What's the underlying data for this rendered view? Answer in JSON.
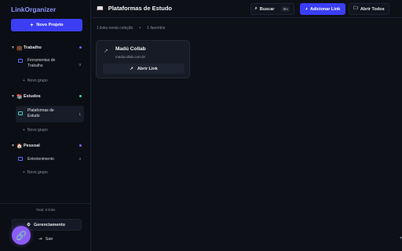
{
  "app": {
    "brand": "LinkOrganizer"
  },
  "sidebar": {
    "new_project_label": "Novo Projeto",
    "groups": [
      {
        "name": "Trabalho",
        "emoji": "💼",
        "dot_color": "#6366f1",
        "collections": [
          {
            "name": "Ferramentas de Trabalho",
            "count": "3"
          }
        ],
        "new_group_label": "Novo grupo"
      },
      {
        "name": "Estudos",
        "emoji": "📚",
        "dot_color": "#2dd4bf",
        "collections": [
          {
            "name": "Plataformas de Estudo",
            "count": "1"
          }
        ],
        "new_group_label": "Novo grupo"
      },
      {
        "name": "Pessoal",
        "emoji": "🏠",
        "dot_color": "#8b5cf6",
        "collections": [
          {
            "name": "Entretenimento",
            "count": "3"
          }
        ],
        "new_group_label": "Novo grupo"
      }
    ],
    "total_links": "Total: 6 links",
    "management_label": "Gerenciamento",
    "logout_label": "Sair"
  },
  "header": {
    "title": "Plataformas de Estudo",
    "search_label": "Buscar",
    "search_shortcut": "⌘K",
    "add_link_label": "Adicionar Link",
    "open_all_label": "Abrir Todos"
  },
  "stats": {
    "links": "1 links nesta coleção",
    "separator": "•",
    "favorites": "1 favoritos"
  },
  "links": [
    {
      "name": "Madú Collab",
      "url": "maducollab.com.br",
      "open_label": "Abrir Link"
    }
  ],
  "colors": {
    "accent": "#3b3ef5",
    "brand": "#8e94ff",
    "background": "#0d1017"
  }
}
